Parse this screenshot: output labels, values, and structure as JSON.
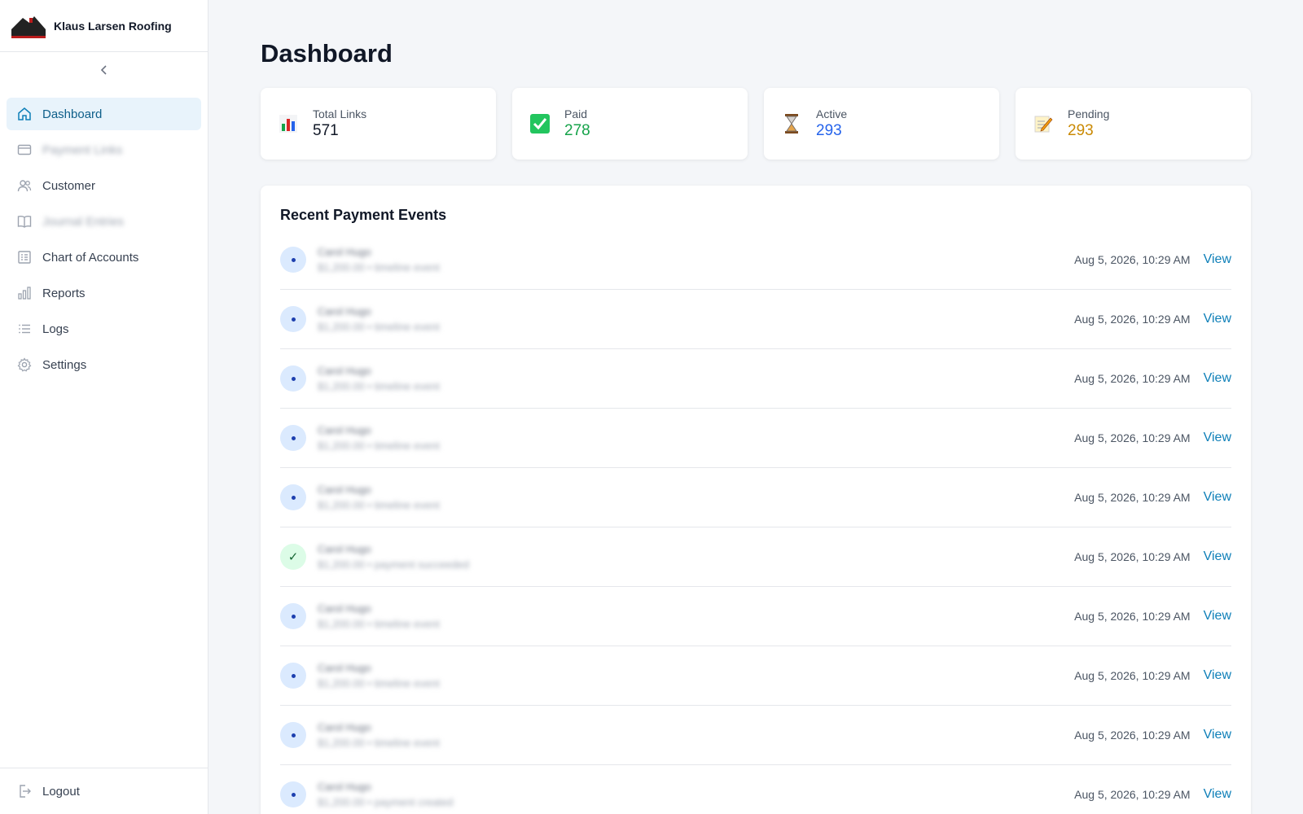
{
  "brand": {
    "name": "Klaus Larsen Roofing"
  },
  "sidebar": {
    "items": [
      {
        "label": "Dashboard",
        "icon": "home-icon",
        "active": true
      },
      {
        "label": "Payment Links",
        "icon": "credit-card-icon",
        "blurred": true
      },
      {
        "label": "Customer",
        "icon": "users-icon"
      },
      {
        "label": "Journal Entries",
        "icon": "book-icon",
        "blurred": true
      },
      {
        "label": "Chart of Accounts",
        "icon": "ledger-icon"
      },
      {
        "label": "Reports",
        "icon": "bar-chart-icon"
      },
      {
        "label": "Logs",
        "icon": "list-icon"
      },
      {
        "label": "Settings",
        "icon": "gear-icon"
      }
    ],
    "logout": "Logout"
  },
  "page": {
    "title": "Dashboard"
  },
  "stats": [
    {
      "label": "Total Links",
      "value": "571",
      "icon": "bar-chart-emoji-icon",
      "color": "#111827"
    },
    {
      "label": "Paid",
      "value": "278",
      "icon": "check-mark-icon",
      "color": "#16a34a"
    },
    {
      "label": "Active",
      "value": "293",
      "icon": "hourglass-icon",
      "color": "#2563eb"
    },
    {
      "label": "Pending",
      "value": "293",
      "icon": "memo-icon",
      "color": "#ca8a04"
    }
  ],
  "events": {
    "title": "Recent Payment Events",
    "view_label": "View",
    "rows": [
      {
        "name": "Carol Hugo",
        "detail": "$1,200.00 • timeline event",
        "time": "Aug 5, 2026, 10:29 AM",
        "status": "event"
      },
      {
        "name": "Carol Hugo",
        "detail": "$1,200.00 • timeline event",
        "time": "Aug 5, 2026, 10:29 AM",
        "status": "event"
      },
      {
        "name": "Carol Hugo",
        "detail": "$1,200.00 • timeline event",
        "time": "Aug 5, 2026, 10:29 AM",
        "status": "event"
      },
      {
        "name": "Carol Hugo",
        "detail": "$1,200.00 • timeline event",
        "time": "Aug 5, 2026, 10:29 AM",
        "status": "event"
      },
      {
        "name": "Carol Hugo",
        "detail": "$1,200.00 • timeline event",
        "time": "Aug 5, 2026, 10:29 AM",
        "status": "event"
      },
      {
        "name": "Carol Hugo",
        "detail": "$1,200.00 • payment succeeded",
        "time": "Aug 5, 2026, 10:29 AM",
        "status": "success"
      },
      {
        "name": "Carol Hugo",
        "detail": "$1,200.00 • timeline event",
        "time": "Aug 5, 2026, 10:29 AM",
        "status": "event"
      },
      {
        "name": "Carol Hugo",
        "detail": "$1,200.00 • timeline event",
        "time": "Aug 5, 2026, 10:29 AM",
        "status": "event"
      },
      {
        "name": "Carol Hugo",
        "detail": "$1,200.00 • timeline event",
        "time": "Aug 5, 2026, 10:29 AM",
        "status": "event"
      },
      {
        "name": "Carol Hugo",
        "detail": "$1,200.00 • payment created",
        "time": "Aug 5, 2026, 10:29 AM",
        "status": "event"
      }
    ]
  }
}
